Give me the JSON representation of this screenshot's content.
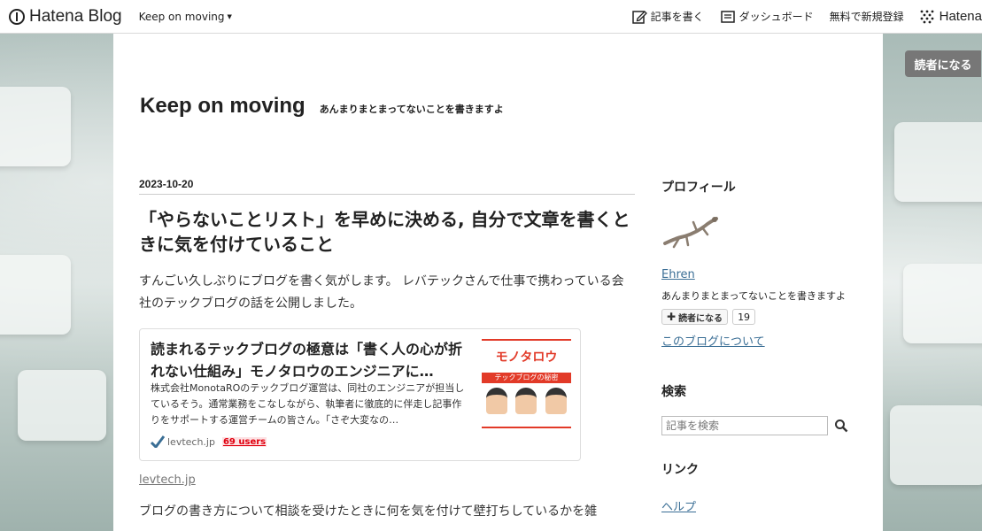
{
  "topbar": {
    "logo_text": "Hatena Blog",
    "blog_menu_label": "Keep on moving",
    "write_label": "記事を書く",
    "dashboard_label": "ダッシュボード",
    "signup_label": "無料で新規登録",
    "hatena_label": "Hatena"
  },
  "float_subscribe_label": "読者になる",
  "blog": {
    "title": "Keep on moving",
    "description": "あんまりまとまってないことを書きますよ"
  },
  "entry": {
    "date": "2023-10-20",
    "title": "「やらないことリスト」を早めに決める, 自分で文章を書くときに気を付けていること",
    "intro": "すんごい久しぶりにブログを書く気がします。 レバテックさんで仕事で携わっている会社のテックブログの話を公開しました。",
    "card": {
      "title": "読まれるテックブログの極意は「書く人の心が折れない仕組み」モノタロウのエンジニアに…",
      "description": "株式会社MonotaROのテックブログ運営は、同社のエンジニアが担当しているそう。通常業務をこなしながら、執筆者に徹底的に伴走し記事作りをサポートする運営チームの皆さん。「さぞ大変なの…",
      "domain": "levtech.jp",
      "users": "69 users",
      "thumb_logo": "モノタロウ",
      "thumb_band": "テックブログの秘密"
    },
    "source_link": "levtech.jp",
    "para2": "ブログの書き方について相談を受けたときに何を気を付けて壁打ちしているかを雑"
  },
  "sidebar": {
    "profile_heading": "プロフィール",
    "profile_name": "Ehren",
    "profile_desc": "あんまりまとまってないことを書きますよ",
    "subscribe_label": "読者になる",
    "subscriber_count": "19",
    "about_link": "このブログについて",
    "search_heading": "検索",
    "search_placeholder": "記事を検索",
    "links_heading": "リンク",
    "help_link": "ヘルプ"
  },
  "colors": {
    "link": "#3a6e95",
    "bookmark_red": "#e0000f",
    "brand_red": "#e23a28"
  }
}
